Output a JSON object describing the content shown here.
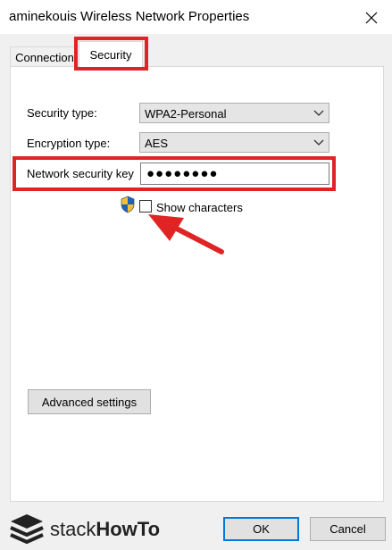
{
  "window": {
    "title": "aminekouis Wireless Network Properties",
    "close_symbol": "✕"
  },
  "tabs": [
    {
      "label": "Connection"
    },
    {
      "label": "Security"
    }
  ],
  "form": {
    "security_type_label": "Security type:",
    "security_type_value": "WPA2-Personal",
    "encryption_type_label": "Encryption type:",
    "encryption_type_value": "AES",
    "network_key_label": "Network security key",
    "network_key_value": "●●●●●●●●",
    "show_characters_label": "Show characters",
    "show_characters_checked": false
  },
  "buttons": {
    "advanced_settings": "Advanced settings",
    "ok": "OK",
    "cancel": "Cancel"
  },
  "watermark": {
    "text_stack": "stack",
    "text_howto": "HowTo"
  },
  "colors": {
    "highlight_red": "#e02424",
    "ok_border_blue": "#0078d7"
  }
}
